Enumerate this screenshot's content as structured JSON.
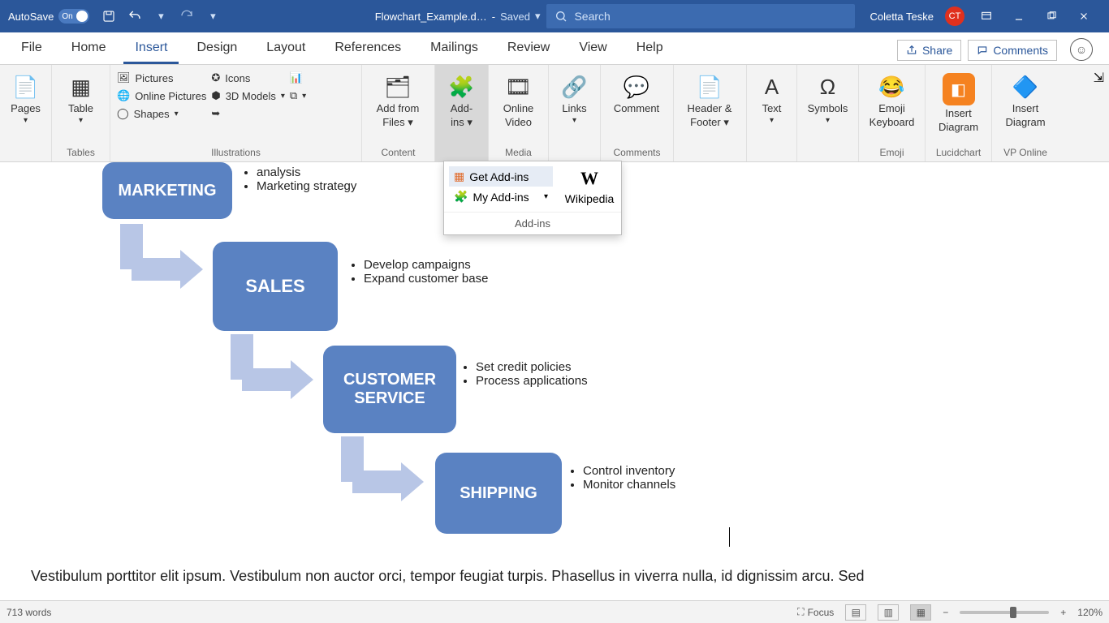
{
  "titlebar": {
    "autosave_label": "AutoSave",
    "autosave_state": "On",
    "filename": "Flowchart_Example.d…",
    "saved_label": "Saved",
    "search_placeholder": "Search",
    "user_name": "Coletta Teske",
    "user_initials": "CT"
  },
  "tabs": {
    "items": [
      "File",
      "Home",
      "Insert",
      "Design",
      "Layout",
      "References",
      "Mailings",
      "Review",
      "View",
      "Help"
    ],
    "active": "Insert",
    "share_label": "Share",
    "comments_label": "Comments"
  },
  "ribbon": {
    "pages_label": "Pages",
    "tables_group": "Tables",
    "table_label": "Table",
    "illustrations_group": "Illustrations",
    "pictures": "Pictures",
    "online_pictures": "Online Pictures",
    "shapes": "Shapes",
    "icons": "Icons",
    "models3d": "3D Models",
    "content_group": "Content",
    "add_from_files_l1": "Add from",
    "add_from_files_l2": "Files",
    "addins_l1": "Add-",
    "addins_l2": "ins",
    "media_group": "Media",
    "online_video_l1": "Online",
    "online_video_l2": "Video",
    "links_label": "Links",
    "comments_group": "Comments",
    "comment_label": "Comment",
    "header_footer_l1": "Header &",
    "header_footer_l2": "Footer",
    "text_label": "Text",
    "symbols_label": "Symbols",
    "emoji_group": "Emoji",
    "emoji_l1": "Emoji",
    "emoji_l2": "Keyboard",
    "lucid_group": "Lucidchart",
    "lucid_l1": "Insert",
    "lucid_l2": "Diagram",
    "vp_group": "VP Online",
    "vp_l1": "Insert",
    "vp_l2": "Diagram"
  },
  "popup": {
    "get_addins": "Get Add-ins",
    "my_addins": "My Add-ins",
    "wikipedia": "Wikipedia",
    "footer": "Add-ins"
  },
  "flow": {
    "box1": "MARKETING",
    "box1_bullets": [
      "analysis",
      "Marketing strategy"
    ],
    "box2": "SALES",
    "box2_bullets": [
      "Develop campaigns",
      "Expand customer base"
    ],
    "box3": "CUSTOMER SERVICE",
    "box3_bullets": [
      "Set credit policies",
      "Process applications"
    ],
    "box4": "SHIPPING",
    "box4_bullets": [
      "Control inventory",
      "Monitor channels"
    ]
  },
  "body_text": "Vestibulum porttitor elit ipsum. Vestibulum non auctor orci, tempor feugiat turpis. Phasellus in viverra nulla, id dignissim arcu. Sed",
  "statusbar": {
    "words": "713 words",
    "focus": "Focus",
    "zoom": "120%"
  }
}
